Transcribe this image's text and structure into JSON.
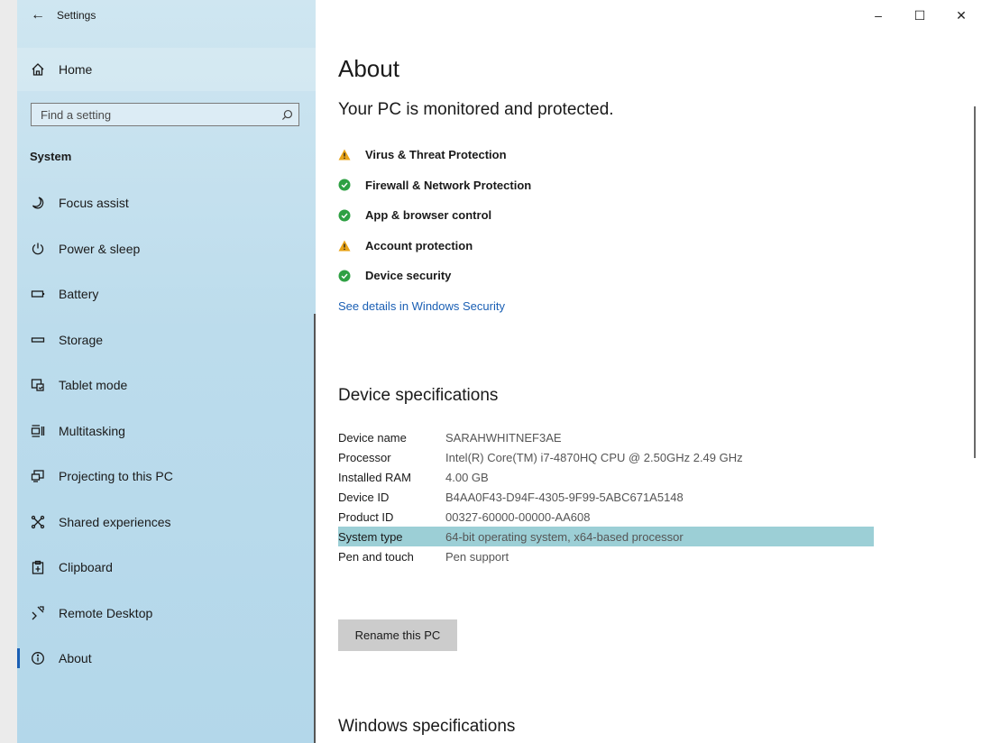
{
  "app": {
    "title": "Settings"
  },
  "window_controls": {
    "minimize": "–",
    "maximize": "☐",
    "close": "✕"
  },
  "sidebar": {
    "home_label": "Home",
    "search_placeholder": "Find a setting",
    "section": "System",
    "items": [
      {
        "label": "Focus assist",
        "icon": "moon-icon"
      },
      {
        "label": "Power & sleep",
        "icon": "power-icon"
      },
      {
        "label": "Battery",
        "icon": "battery-icon"
      },
      {
        "label": "Storage",
        "icon": "storage-icon"
      },
      {
        "label": "Tablet mode",
        "icon": "tablet-mode-icon"
      },
      {
        "label": "Multitasking",
        "icon": "multitasking-icon"
      },
      {
        "label": "Projecting to this PC",
        "icon": "projector-icon"
      },
      {
        "label": "Shared experiences",
        "icon": "shared-icon"
      },
      {
        "label": "Clipboard",
        "icon": "clipboard-icon"
      },
      {
        "label": "Remote Desktop",
        "icon": "remote-desktop-icon"
      },
      {
        "label": "About",
        "icon": "info-icon",
        "active": true
      }
    ]
  },
  "main": {
    "title": "About",
    "protection_heading": "Your PC is monitored and protected.",
    "security_items": [
      {
        "label": "Virus & Threat Protection",
        "status": "warning"
      },
      {
        "label": "Firewall & Network Protection",
        "status": "ok"
      },
      {
        "label": "App & browser control",
        "status": "ok"
      },
      {
        "label": "Account protection",
        "status": "warning"
      },
      {
        "label": "Device security",
        "status": "ok"
      }
    ],
    "security_link": "See details in Windows Security",
    "device_spec_heading": "Device specifications",
    "specs": [
      {
        "key": "Device name",
        "value": "SARAHWHITNEF3AE"
      },
      {
        "key": "Processor",
        "value": "Intel(R) Core(TM) i7-4870HQ CPU @ 2.50GHz   2.49 GHz"
      },
      {
        "key": "Installed RAM",
        "value": "4.00 GB"
      },
      {
        "key": "Device ID",
        "value": "B4AA0F43-D94F-4305-9F99-5ABC671A5148"
      },
      {
        "key": "Product ID",
        "value": "00327-60000-00000-AA608"
      },
      {
        "key": "System type",
        "value": "64-bit operating system, x64-based processor",
        "highlighted": true
      },
      {
        "key": "Pen and touch",
        "value": "Pen support"
      }
    ],
    "rename_button": "Rename this PC",
    "windows_spec_heading": "Windows specifications"
  },
  "colors": {
    "accent": "#1a5fb4",
    "warning": "#e8a317",
    "ok": "#2ea043",
    "highlight": "#9ccfd6"
  }
}
